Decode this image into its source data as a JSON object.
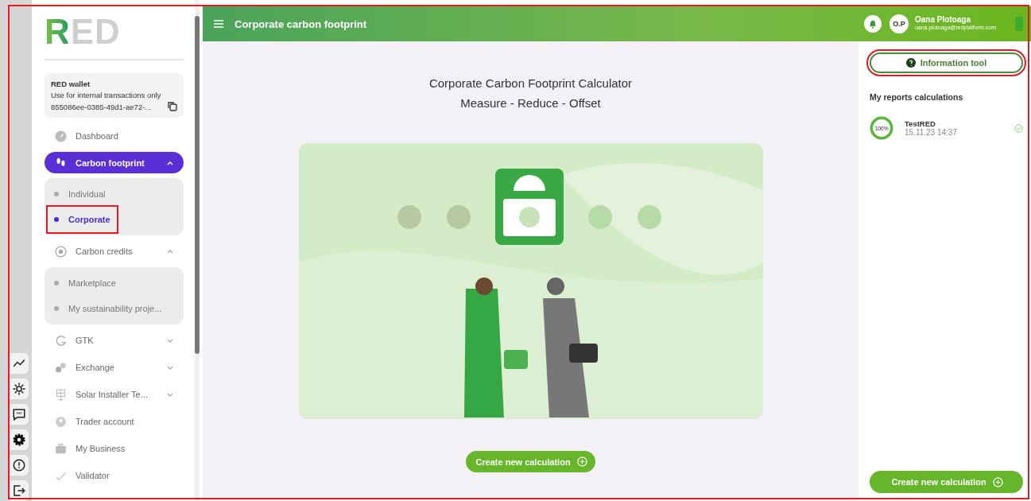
{
  "frame_highlighted": true,
  "sidebar": {
    "logo": "RED",
    "wallet": {
      "title": "RED wallet",
      "subtitle": "Use for internal transactions only",
      "address": "855086ee-0385-49d1-ae72-..."
    },
    "items": [
      {
        "label": "Dashboard",
        "selected": false
      },
      {
        "label": "Carbon footprint",
        "selected": true,
        "expanded": true,
        "children": [
          {
            "label": "Individual",
            "selected": false,
            "highlighted": false
          },
          {
            "label": "Corporate",
            "selected": true,
            "highlighted": true
          }
        ]
      },
      {
        "label": "Carbon credits",
        "selected": false,
        "expanded": true,
        "children": [
          {
            "label": "Marketplace",
            "selected": false,
            "highlighted": false
          },
          {
            "label": "My sustainability proje...",
            "selected": false,
            "highlighted": false
          }
        ]
      },
      {
        "label": "GTK",
        "selected": false,
        "expanded": false
      },
      {
        "label": "Exchange",
        "selected": false,
        "expanded": false
      },
      {
        "label": "Solar Installer Te...",
        "selected": false,
        "expanded": false
      },
      {
        "label": "Trader account",
        "selected": false
      },
      {
        "label": "My Business",
        "selected": false
      },
      {
        "label": "Validator",
        "selected": false
      }
    ]
  },
  "side_tools": [
    {
      "kind": "chart"
    },
    {
      "kind": "sun"
    },
    {
      "kind": "chat"
    },
    {
      "kind": "gear"
    },
    {
      "kind": "alert"
    },
    {
      "kind": "logout"
    }
  ],
  "topbar": {
    "title": "Corporate carbon footprint",
    "avatar": "O.P",
    "user_name": "Oana Plotoaga",
    "user_email": "oana.plotoaga@redplatform.com"
  },
  "main": {
    "heading": "Corporate Carbon Footprint Calculator",
    "subheading": "Measure - Reduce - Offset",
    "button": "Create new calculation"
  },
  "right_panel": {
    "info_button": {
      "label": "Information tool",
      "highlighted": true
    },
    "section_title": "My reports calculations",
    "reports": [
      {
        "progress": "100%",
        "level": 1,
        "name": "TestRED",
        "date": "15.11.23 14:37",
        "done": true
      }
    ],
    "button": "Create new calculation"
  }
}
